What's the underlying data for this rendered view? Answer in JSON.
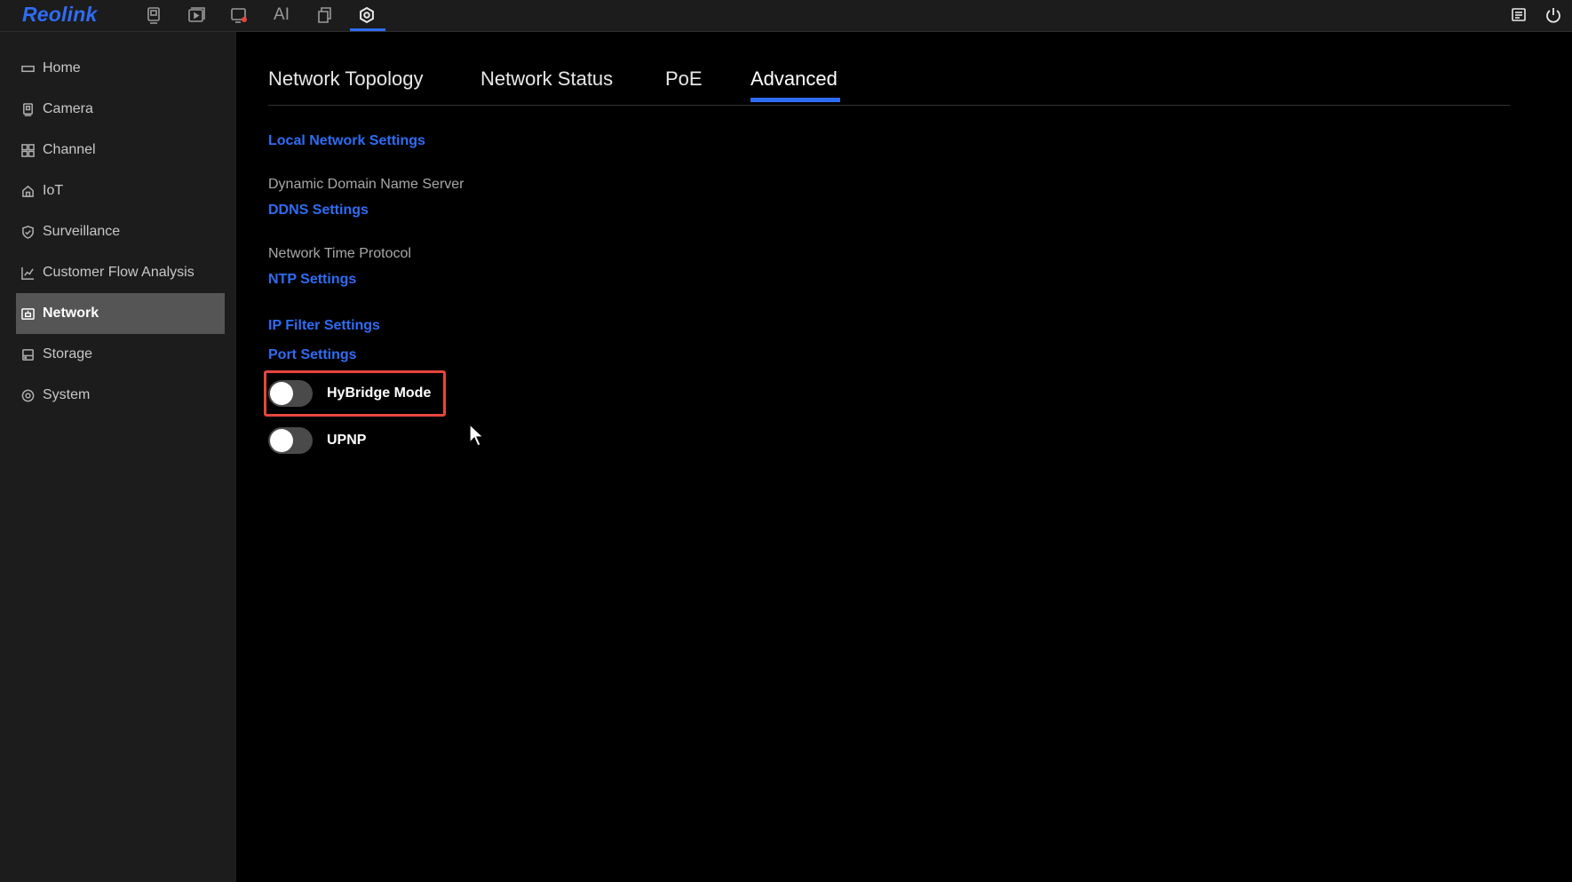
{
  "header": {
    "logo": "Reolink",
    "icons": [
      {
        "name": "live-view-icon"
      },
      {
        "name": "playback-icon"
      },
      {
        "name": "alarm-icon"
      },
      {
        "name": "ai-icon",
        "label": "AI"
      },
      {
        "name": "file-icon"
      },
      {
        "name": "settings-icon",
        "active": true
      }
    ],
    "right_icons": [
      "message-icon",
      "power-icon"
    ],
    "accent_color": "#2f6cf5"
  },
  "sidebar": {
    "items": [
      {
        "label": "Home",
        "icon": "home-icon"
      },
      {
        "label": "Camera",
        "icon": "camera-icon"
      },
      {
        "label": "Channel",
        "icon": "channel-icon"
      },
      {
        "label": "IoT",
        "icon": "iot-icon"
      },
      {
        "label": "Surveillance",
        "icon": "shield-icon"
      },
      {
        "label": "Customer Flow Analysis",
        "icon": "chart-icon"
      },
      {
        "label": "Network",
        "icon": "network-icon",
        "selected": true
      },
      {
        "label": "Storage",
        "icon": "storage-icon"
      },
      {
        "label": "System",
        "icon": "system-icon"
      }
    ]
  },
  "main": {
    "tabs": [
      {
        "label": "Network Topology"
      },
      {
        "label": "Network Status"
      },
      {
        "label": "PoE"
      },
      {
        "label": "Advanced",
        "active": true
      }
    ],
    "local_network_link": "Local Network Settings",
    "ddns_heading": "Dynamic Domain Name Server",
    "ddns_link": "DDNS Settings",
    "ntp_heading": "Network Time Protocol",
    "ntp_link": "NTP Settings",
    "ip_filter_link": "IP Filter Settings",
    "port_link": "Port Settings",
    "toggles": [
      {
        "label": "HyBridge Mode",
        "on": false,
        "highlighted": true
      },
      {
        "label": "UPNP",
        "on": false
      }
    ],
    "highlight_color": "#e8453c"
  }
}
